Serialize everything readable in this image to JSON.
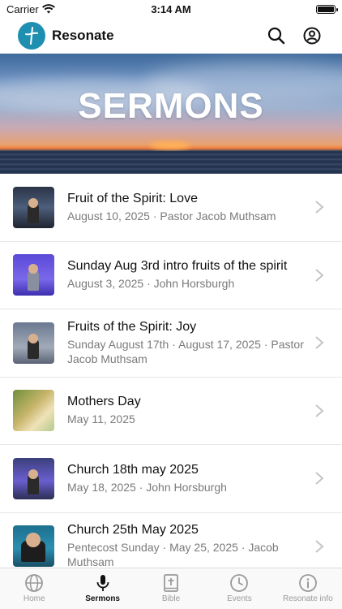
{
  "status_bar": {
    "carrier": "Carrier",
    "time": "3:14 AM"
  },
  "header": {
    "title": "Resonate",
    "icons": [
      "search-icon",
      "account-icon"
    ]
  },
  "hero": {
    "title": "SERMONS"
  },
  "sermons": [
    {
      "title": "Fruit of the Spirit: Love",
      "subtitle": "August 10, 2025 · Pastor Jacob Muthsam"
    },
    {
      "title": "Sunday Aug 3rd intro fruits of the spirit",
      "subtitle": "August 3, 2025 · John Horsburgh"
    },
    {
      "title": "Fruits of the Spirit: Joy",
      "subtitle": "Sunday August 17th · August 17, 2025 · Pastor Jacob Muthsam"
    },
    {
      "title": "Mothers Day",
      "subtitle": "May 11, 2025"
    },
    {
      "title": "Church 18th may 2025",
      "subtitle": "May 18, 2025 · John Horsburgh"
    },
    {
      "title": "Church 25th May 2025",
      "subtitle": "Pentecost Sunday · May 25, 2025 · Jacob Muthsam"
    }
  ],
  "tabs": [
    {
      "label": "Home",
      "icon": "globe-icon"
    },
    {
      "label": "Sermons",
      "icon": "microphone-icon",
      "active": true
    },
    {
      "label": "Bible",
      "icon": "bible-icon"
    },
    {
      "label": "Events",
      "icon": "clock-icon"
    },
    {
      "label": "Resonate info",
      "icon": "info-icon"
    }
  ],
  "colors": {
    "brand": "#1e8fb0",
    "active_tab": "#111111",
    "inactive_tab": "#9a9a9a"
  }
}
